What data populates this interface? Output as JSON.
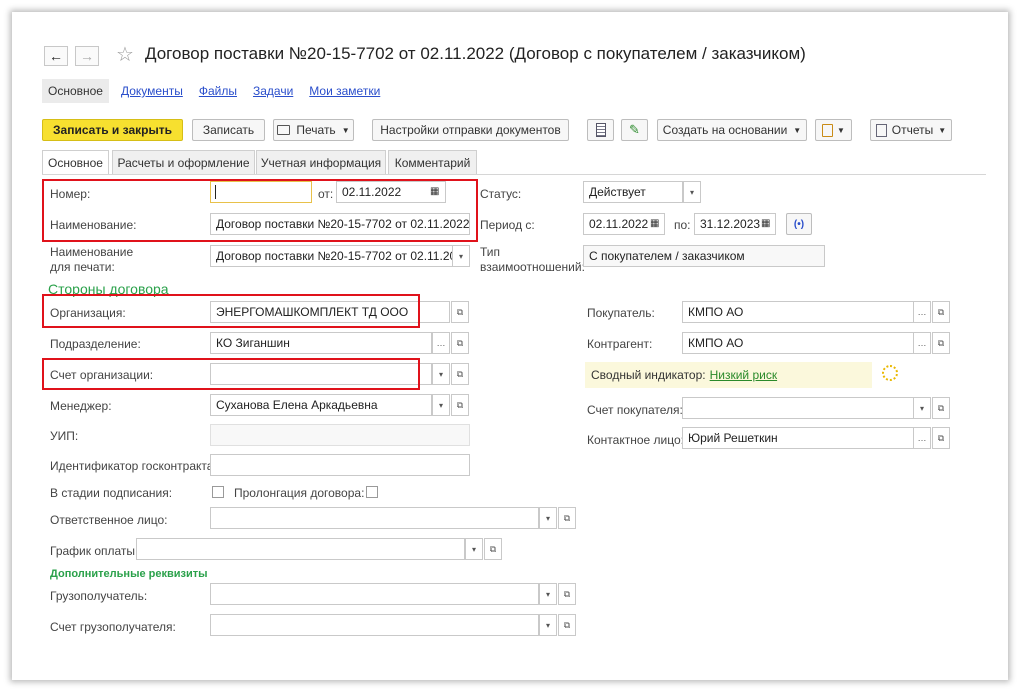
{
  "title": "Договор поставки №20-15-7702 от 02.11.2022 (Договор с покупателем / заказчиком)",
  "nav": {
    "back": "←",
    "forward": "→",
    "favorite": "☆"
  },
  "top_tabs": [
    {
      "label": "Основное"
    },
    {
      "label": "Документы"
    },
    {
      "label": "Файлы"
    },
    {
      "label": "Задачи"
    },
    {
      "label": "Мои заметки"
    }
  ],
  "toolbar": {
    "save_close": "Записать и закрыть",
    "save": "Записать",
    "print": "Печать",
    "send_settings": "Настройки отправки документов",
    "create_based": "Создать на основании",
    "reports": "Отчеты"
  },
  "tabs": [
    {
      "label": "Основное"
    },
    {
      "label": "Расчеты и оформление"
    },
    {
      "label": "Учетная информация"
    },
    {
      "label": "Комментарий"
    }
  ],
  "form": {
    "number_label": "Номер:",
    "number_value": "",
    "from_label": "от:",
    "date_value": "02.11.2022",
    "name_label": "Наименование:",
    "name_value": "Договор поставки №20-15-7702 от 02.11.2022",
    "print_name_label_1": "Наименование",
    "print_name_label_2": "для печати:",
    "print_name_value": "Договор поставки №20-15-7702 от 02.11.20",
    "parties_header": "Стороны договора",
    "org_label": "Организация:",
    "org_value": "ЭНЕРГОМАШКОМПЛЕКТ ТД ООО",
    "division_label": "Подразделение:",
    "division_value": "КО Зиганшин",
    "org_account_label": "Счет организации:",
    "org_account_value": "",
    "manager_label": "Менеджер:",
    "manager_value": "Суханова Елена Аркадьевна",
    "uip_label": "УИП:",
    "uip_value": "",
    "gov_id_label": "Идентификатор госконтракта:",
    "gov_id_value": "",
    "signing_label": "В стадии подписания:",
    "prolong_label": "Пролонгация договора:",
    "responsible_label": "Ответственное лицо:",
    "responsible_value": "",
    "schedule_label": "График оплаты:",
    "schedule_value": "",
    "extra_header": "Дополнительные реквизиты",
    "consignee_label": "Грузополучатель:",
    "consignee_value": "",
    "consignee_acc_label": "Счет грузополучателя:",
    "consignee_acc_value": "",
    "status_label": "Статус:",
    "status_value": "Действует",
    "period_label": "Период с:",
    "period_from": "02.11.2022",
    "period_to_label": "по:",
    "period_to": "31.12.2023",
    "relation_label_1": "Тип",
    "relation_label_2": "взаимоотношений:",
    "relation_value": "С покупателем / заказчиком",
    "buyer_label": "Покупатель:",
    "buyer_value": "КМПО АО",
    "counterparty_label": "Контрагент:",
    "counterparty_value": "КМПО АО",
    "indicator_label": "Сводный индикатор:",
    "indicator_value": "Низкий риск",
    "buyer_account_label": "Счет покупателя:",
    "buyer_account_value": "",
    "contact_label": "Контактное лицо:",
    "contact_value": "Юрий Решеткин"
  },
  "colors": {
    "accent_yellow": "#f7e02f",
    "highlight_red": "#e0121b",
    "section_green": "#2aa14a",
    "link_blue": "#2a4ecb"
  }
}
